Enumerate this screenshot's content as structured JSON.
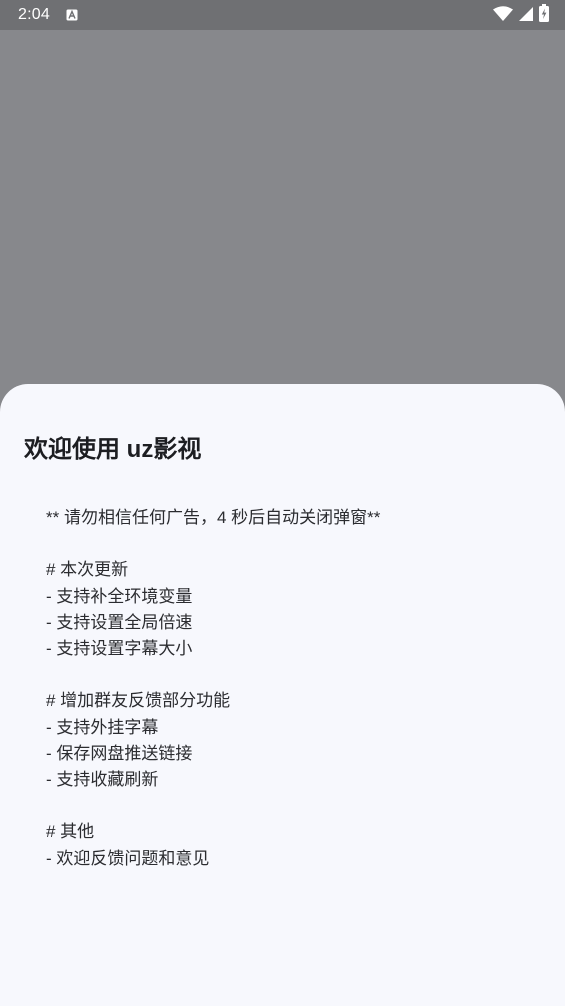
{
  "status_bar": {
    "time": "2:04",
    "notification_icon": "font-a-icon",
    "icons": [
      "wifi-icon",
      "signal-icon",
      "battery-charging-icon"
    ]
  },
  "dialog": {
    "title": "欢迎使用 uz影视",
    "lines": [
      "** 请勿相信任何广告，4 秒后自动关闭弹窗**",
      "",
      "# 本次更新",
      "- 支持补全环境变量",
      "- 支持设置全局倍速",
      "- 支持设置字幕大小",
      "",
      "# 增加群友反馈部分功能",
      "- 支持外挂字幕",
      "- 保存网盘推送链接",
      "- 支持收藏刷新",
      "",
      "# 其他",
      "- 欢迎反馈问题和意见"
    ]
  },
  "colors": {
    "scrim": "#87888c",
    "status_bar": "#6f7073",
    "sheet": "#f7f8fd",
    "title_text": "#1d1e22",
    "body_text": "#2b2c30"
  }
}
